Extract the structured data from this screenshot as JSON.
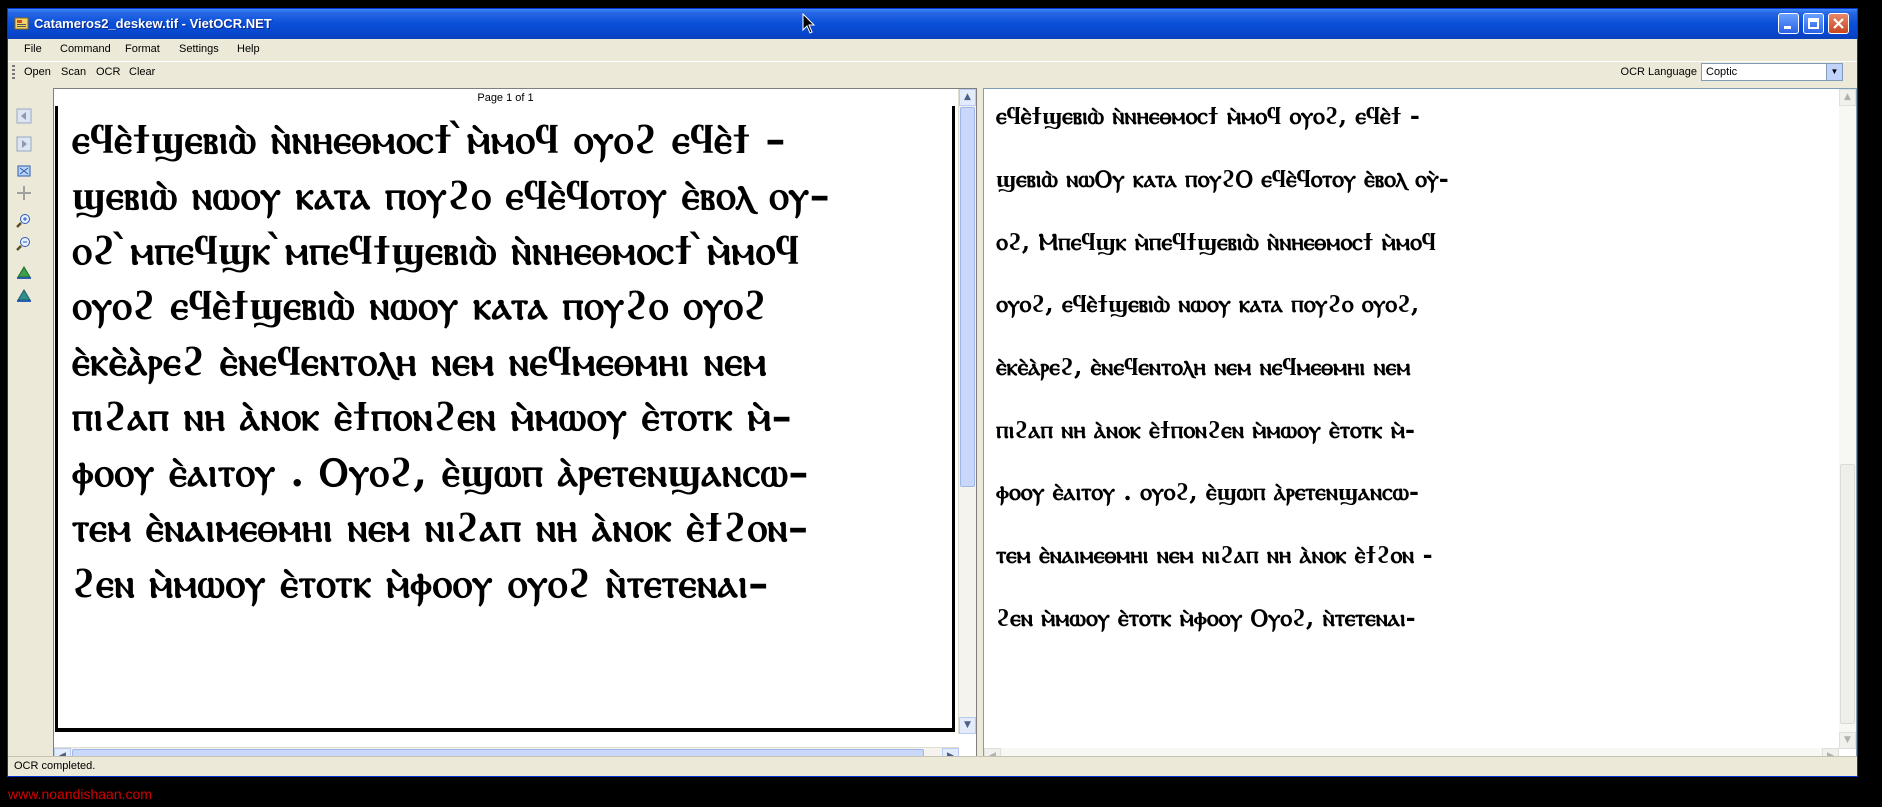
{
  "window": {
    "title": "Catameros2_deskew.tif - VietOCR.NET"
  },
  "menu": [
    "File",
    "Command",
    "Format",
    "Settings",
    "Help"
  ],
  "toolbar": {
    "buttons": [
      "Open",
      "Scan",
      "OCR",
      "Clear"
    ],
    "ocr_language_label": "OCR Language",
    "ocr_language_value": "Coptic"
  },
  "left_tools": [
    "prev-page-icon",
    "next-page-icon",
    "fit-image-icon",
    "actual-size-icon",
    "zoom-in-icon",
    "zoom-out-icon",
    "rotate-left-icon",
    "rotate-right-icon"
  ],
  "image_panel": {
    "page_info": "Page 1 of 1",
    "scan_lines": [
      "ⲉϥⲉ̀ϯϣⲉⲃⲓⲱ̀ ⲛ̀ⲛⲏⲉⲑⲙⲟⲥϯ ̀ⲙ̀ⲙⲟϥ ⲟⲩⲟϩ ⲉϥⲉ̀ϯ –",
      "ϣⲉⲃⲓⲱ̀ ⲛⲱⲟⲩ ⲕⲁⲧⲁ ⲡⲟⲩϩⲟ ⲉϥⲉ̀ϥⲟⲧⲟⲩ ⲉ̀ⲃⲟⲗ ⲟⲩ–",
      "ⲟϩ ̀ⲙⲡⲉϥϣⲕ ̀ⲙⲡⲉϥϯϣⲉⲃⲓⲱ̀ ⲛ̀ⲛⲏⲉⲑⲙⲟⲥϯ ̀ⲙ̀ⲙⲟϥ",
      "ⲟⲩⲟϩ ⲉϥⲉ̀ϯϣⲉⲃⲓⲱ̀ ⲛⲱⲟⲩ ⲕⲁⲧⲁ ⲡⲟⲩϩⲟ ⲟⲩⲟϩ",
      "ⲉ̀ⲕⲉ̀ⲁ̀ⲣⲉϩ ⲉ̀ⲛⲉϥⲉⲛⲧⲟⲗⲏ ⲛⲉⲙ ⲛⲉϥⲙⲉⲑⲙⲏⲓ ⲛⲉⲙ",
      "ⲡⲓϩⲁⲡ ⲛⲏ ⲁ̀ⲛⲟⲕ ⲉ̀ϯⲡⲟⲛϩⲉⲛ ⲙ̀ⲙⲱⲟⲩ ⲉ̀ⲧⲟⲧⲕ ⲙ̀–",
      "ⲫⲟⲟⲩ ⲉ̀ⲁⲓⲧⲟⲩ . Ⲟⲩⲟϩ, ⲉ̀ϣⲱⲡ ⲁ̀ⲣⲉⲧⲉⲛϣⲁⲛⲥⲱ–",
      "ⲧⲉⲙ ⲉ̀ⲛⲁⲓⲙⲉⲑⲙⲏⲓ ⲛⲉⲙ ⲛⲓϩⲁⲡ ⲛⲏ ⲁ̀ⲛⲟⲕ ⲉ̀ϯϩⲟⲛ–",
      "ϩⲉⲛ ⲙ̀ⲙⲱⲟⲩ ⲉ̀ⲧⲟⲧⲕ ⲙ̀ⲫⲟⲟⲩ ⲟⲩⲟϩ ⲛ̀ⲧⲉⲧⲉⲛⲁⲓ–"
    ]
  },
  "text_panel": {
    "lines": [
      "ⲉϥⲉ̀ϯϣⲉⲃⲓⲱ̀ ⲛ̀ⲛⲏⲉⲑⲙⲟⲥϯ ⲙ̀ⲙⲟϥ ⲟⲩⲟϩ, ⲉϥⲉ̀ϯ -",
      "ϣⲉⲃⲓⲱ̀ ⲛⲱⲞⲩ ⲕⲁⲧⲁ ⲡⲟⲩϩⲞ ⲉϥⲉ̀ϥⲟⲧⲟⲩ ⲉ̀ⲃⲟⲗ ⲟⲩ̀-",
      "ⲟϩ, Ⲙⲡⲉϥϣⲕ ⲙ̀ⲡⲉϥϯϣⲉⲃⲓⲱ̀ ⲛ̀ⲛⲏⲉⲑⲙⲟⲥϯ ⲙ̀ⲙⲟϥ",
      "ⲟⲩⲟϩ, ⲉϥⲉ̀ϯϣⲉⲃⲓⲱ̀ ⲛⲱⲟⲩ ⲕⲁⲧⲁ ⲡⲟⲩϩⲟ ⲟⲩⲟϩ,",
      "ⲉ̀ⲕⲉ̀ⲁ̀ⲣⲉϩ, ⲉ̀ⲛⲉϥⲉⲛⲧⲟⲗⲏ ⲛⲉⲙ ⲛⲉϥⲙⲉⲑⲙⲏⲓ ⲛⲉⲙ",
      "ⲡⲓϩⲁⲡ ⲛⲏ ⲁ̀ⲛⲟⲕ ⲉ̀ϯⲡⲟⲛϩⲉⲛ ⲙ̀ⲙⲱⲟⲩ ⲉ̀ⲧⲟⲧⲕ ⲙ̀-",
      "ⲫⲟⲟⲩ ⲉ̀ⲁⲓⲧⲟⲩ . ⲟⲩⲟϩ, ⲉ̀ϣⲱⲡ ⲁ̀ⲣⲉⲧⲉⲛϣⲁⲛⲥⲱ-",
      "ⲧⲉⲙ ⲉ̀ⲛⲁⲓⲙⲉⲑⲙⲏⲓ ⲛⲉⲙ ⲛⲓϩⲁⲡ ⲛⲏ ⲁ̀ⲛⲟⲕ ⲉ̀ϯϩⲟⲛ -",
      "ϩⲉⲛ ⲙ̀ⲙⲱⲟⲩ ⲉ̀ⲧⲟⲧⲕ ⲙ̀ⲫⲟⲟⲩ Ⲟⲩⲟϩ, ⲛ̀ⲧⲉⲧⲉⲛⲁⲓ-"
    ]
  },
  "status": {
    "text": "OCR completed."
  },
  "watermark": "www.noandishaan.com"
}
